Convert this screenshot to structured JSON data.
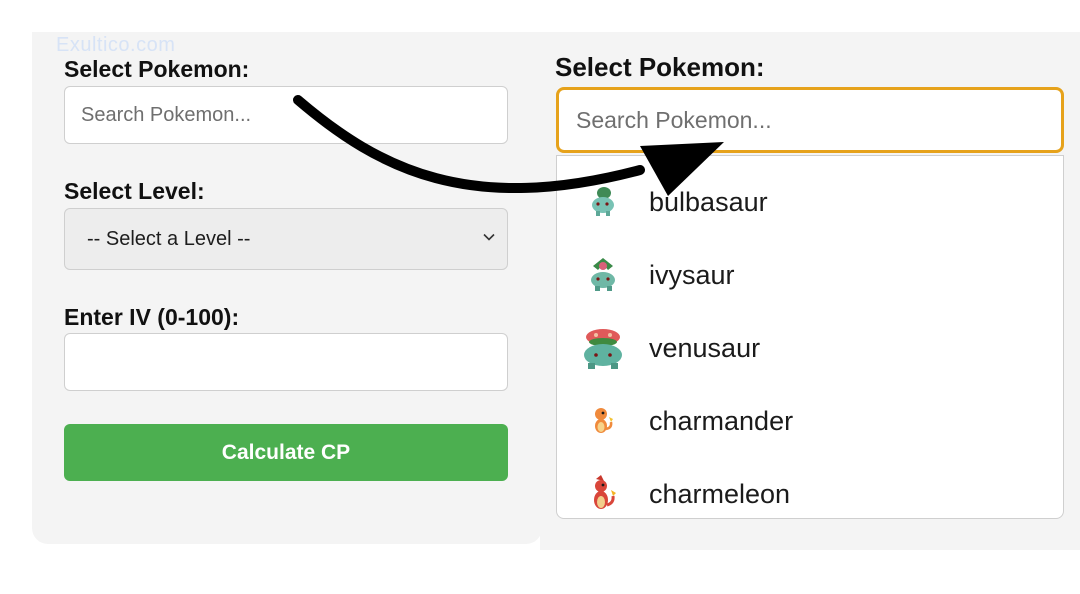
{
  "watermark": "Exultico.com",
  "left": {
    "pokemon_label": "Select Pokemon:",
    "pokemon_placeholder": "Search Pokemon...",
    "level_label": "Select Level:",
    "level_selected": "-- Select a Level --",
    "iv_label": "Enter IV (0-100):",
    "iv_value": "",
    "calc_button": "Calculate CP"
  },
  "right": {
    "pokemon_label": "Select Pokemon:",
    "pokemon_placeholder": "Search Pokemon...",
    "options": [
      {
        "name": "bulbasaur",
        "icon": "bulbasaur-sprite-icon"
      },
      {
        "name": "ivysaur",
        "icon": "ivysaur-sprite-icon"
      },
      {
        "name": "venusaur",
        "icon": "venusaur-sprite-icon"
      },
      {
        "name": "charmander",
        "icon": "charmander-sprite-icon"
      },
      {
        "name": "charmeleon",
        "icon": "charmeleon-sprite-icon"
      }
    ]
  },
  "colors": {
    "accent_button": "#4caf50",
    "focus_border": "#e6a21b",
    "panel_bg": "#f4f4f4"
  }
}
